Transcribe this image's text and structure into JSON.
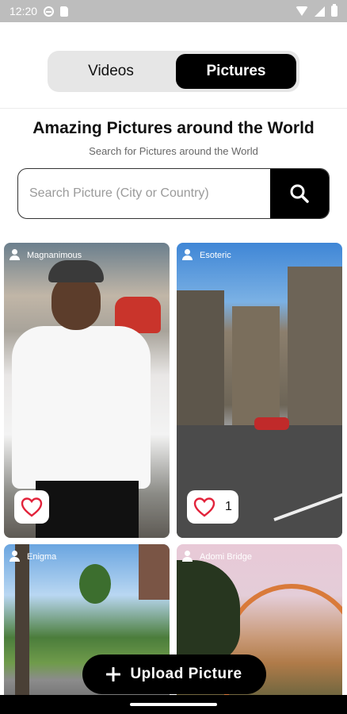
{
  "status_bar": {
    "time": "12:20"
  },
  "tabs": [
    {
      "label": "Videos",
      "active": false
    },
    {
      "label": "Pictures",
      "active": true
    }
  ],
  "header": {
    "title": "Amazing Pictures around the World",
    "subtitle": "Search for Pictures around the World"
  },
  "search": {
    "placeholder": "Search Picture (City or Country)",
    "value": ""
  },
  "pictures": [
    {
      "author": "Magnanimous",
      "likes": ""
    },
    {
      "author": "Esoteric",
      "likes": "1"
    },
    {
      "author": "Enigma"
    },
    {
      "author": "Adomi Bridge"
    }
  ],
  "upload": {
    "label": "Upload Picture"
  },
  "colors": {
    "accent": "#000000",
    "toggle_bg": "#e6e6e6",
    "heart": "#e2233b"
  }
}
